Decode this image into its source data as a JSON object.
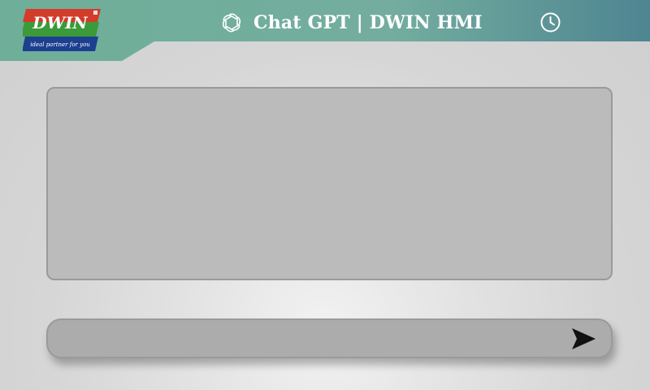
{
  "app": {
    "title": "Chat GPT | DWIN HMI"
  },
  "logo": {
    "brand": "DWIN",
    "tagline": "ideal partner for you"
  },
  "icons": {
    "title_icon": "openai-icon",
    "clock_icon": "clock-icon",
    "send_icon": "send-arrow-icon"
  },
  "chat": {
    "messages": []
  },
  "input": {
    "value": ""
  },
  "colors": {
    "header_left": "#6fae98",
    "header_right": "#4e8592",
    "chat_area_bg": "#bbbbbb",
    "input_bg": "#acacac",
    "logo_red": "#d33b2a",
    "logo_green": "#3c9a3a",
    "logo_blue": "#1c3f8f"
  }
}
